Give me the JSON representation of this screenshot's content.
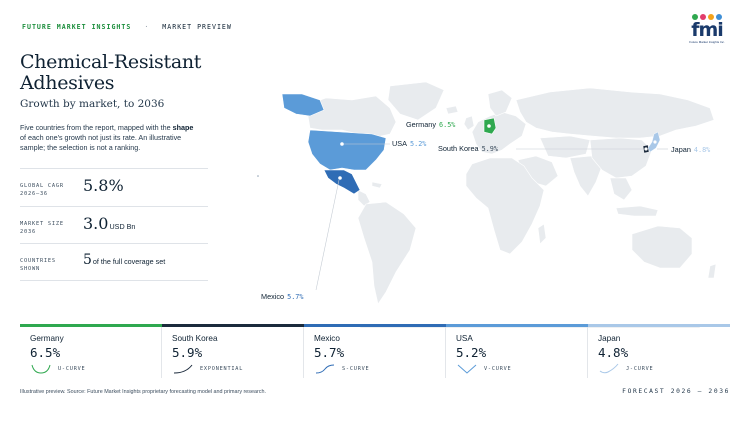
{
  "header": {
    "brand": "FUTURE MARKET INSIGHTS",
    "separator": "·",
    "section": "MARKET PREVIEW",
    "logo": {
      "wordmark": "fmi",
      "tagline": "Future Market Insights Inc."
    }
  },
  "title": "Chemical-Resistant Adhesives",
  "subtitle": "Growth by market, to 2036",
  "description": {
    "part1": "Five countries from the report, mapped with the ",
    "emphasis": "shape",
    "part2": " of each one's growth not just its rate. An illustrative sample; the selection is not a ranking."
  },
  "stats": [
    {
      "label_line1": "GLOBAL CAGR",
      "label_line2": "2026–36",
      "value": "5.8%",
      "unit": ""
    },
    {
      "label_line1": "MARKET SIZE",
      "label_line2": "2036",
      "value": "3.0",
      "unit": "USD Bn"
    },
    {
      "label_line1": "COUNTRIES",
      "label_line2": "SHOWN",
      "value": "5",
      "unit": "of the full coverage set"
    }
  ],
  "map_labels": [
    {
      "country": "Germany",
      "rate": "6.5%"
    },
    {
      "country": "USA",
      "rate": "5.2%"
    },
    {
      "country": "South Korea",
      "rate": "5.9%"
    },
    {
      "country": "Japan",
      "rate": "4.8%"
    },
    {
      "country": "Mexico",
      "rate": "5.7%"
    }
  ],
  "countries": [
    {
      "name": "Germany",
      "rate": "6.5%",
      "shape": "U-CURVE",
      "color": "#2fa84f",
      "curve_icon": "u-curve-icon"
    },
    {
      "name": "South Korea",
      "rate": "5.9%",
      "shape": "EXPONENTIAL",
      "color": "#1b2a3c",
      "curve_icon": "exponential-curve-icon"
    },
    {
      "name": "Mexico",
      "rate": "5.7%",
      "shape": "S-CURVE",
      "color": "#2f6cb5",
      "curve_icon": "s-curve-icon"
    },
    {
      "name": "USA",
      "rate": "5.2%",
      "shape": "V-CURVE",
      "color": "#5b9bd8",
      "curve_icon": "v-curve-icon"
    },
    {
      "name": "Japan",
      "rate": "4.8%",
      "shape": "J-CURVE",
      "color": "#a9c8e8",
      "curve_icon": "j-curve-icon"
    }
  ],
  "colors": {
    "land": "#e8ebee",
    "germany": "#2fa84f",
    "south_korea": "#1b2a3c",
    "mexico": "#2f6cb5",
    "usa": "#5b9bd8",
    "japan": "#a9c8e8",
    "brand_green": "#1e8f3e",
    "text": "#0f2233"
  },
  "footer": {
    "note": "Illustrative preview. Source: Future Market Insights proprietary forecasting model and primary research.",
    "forecast": "FORECAST 2026 – 2036"
  }
}
